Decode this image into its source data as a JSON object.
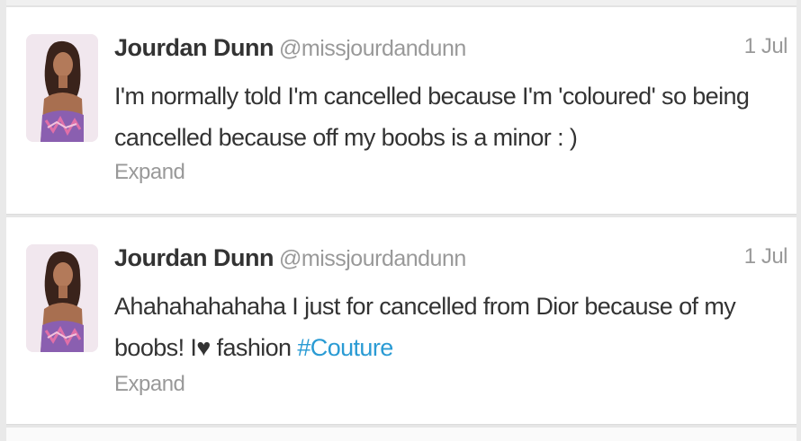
{
  "tweets": [
    {
      "name": "Jourdan Dunn",
      "handle": "@missjourdandunn",
      "time": "1 Jul",
      "text": "I'm normally told I'm cancelled because I'm 'coloured' so being cancelled because off my  boobs is a minor : )",
      "expand": "Expand"
    },
    {
      "name": "Jourdan Dunn",
      "handle": "@missjourdandunn",
      "time": "1 Jul",
      "text_before": "Ahahahahahaha I  just for cancelled from Dior because of my boobs! I♥ fashion ",
      "hashtag": "#Couture",
      "expand": "Expand"
    }
  ],
  "colors": {
    "name": "#333333",
    "secondary": "#999999",
    "hashtag": "#2a9bd4",
    "border": "#e6e6e6"
  }
}
